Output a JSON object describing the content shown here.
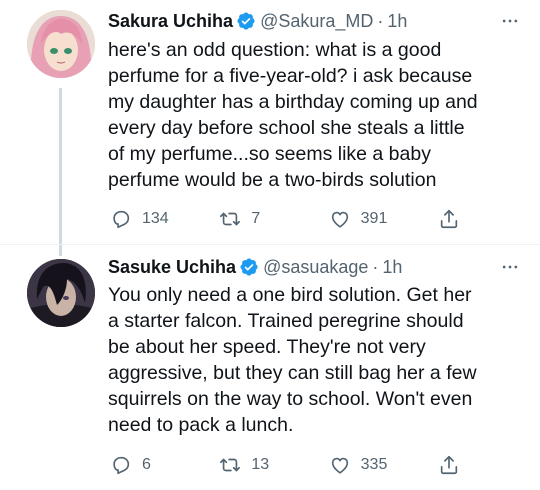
{
  "tweets": [
    {
      "display_name": "Sakura Uchiha",
      "handle": "@Sakura_MD",
      "separator": "·",
      "time": "1h",
      "text": "here's an odd question: what is a good\nperfume for a five-year-old? i ask because\nmy daughter has a birthday coming up and\nevery day before school she steals a little\nof my perfume...so seems like a baby\nperfume would be a two-birds solution",
      "replies": "134",
      "retweets": "7",
      "likes": "391"
    },
    {
      "display_name": "Sasuke Uchiha",
      "handle": "@sasuakage",
      "separator": "·",
      "time": "1h",
      "text": "You only need a one bird solution. Get her\na starter falcon. Trained peregrine should\nbe about her speed. They're not very\naggressive, but they can still bag her a few\nsquirrels on the way to school. Won't even\nneed to pack a lunch.",
      "replies": "6",
      "retweets": "13",
      "likes": "335"
    }
  ],
  "colors": {
    "verified": "#1d9bf0",
    "text": "#0f1419",
    "secondary": "#536471",
    "thread_line": "#cfd9de"
  },
  "icons": [
    "verified-badge-icon",
    "more-icon",
    "reply-icon",
    "retweet-icon",
    "like-icon",
    "share-icon"
  ]
}
